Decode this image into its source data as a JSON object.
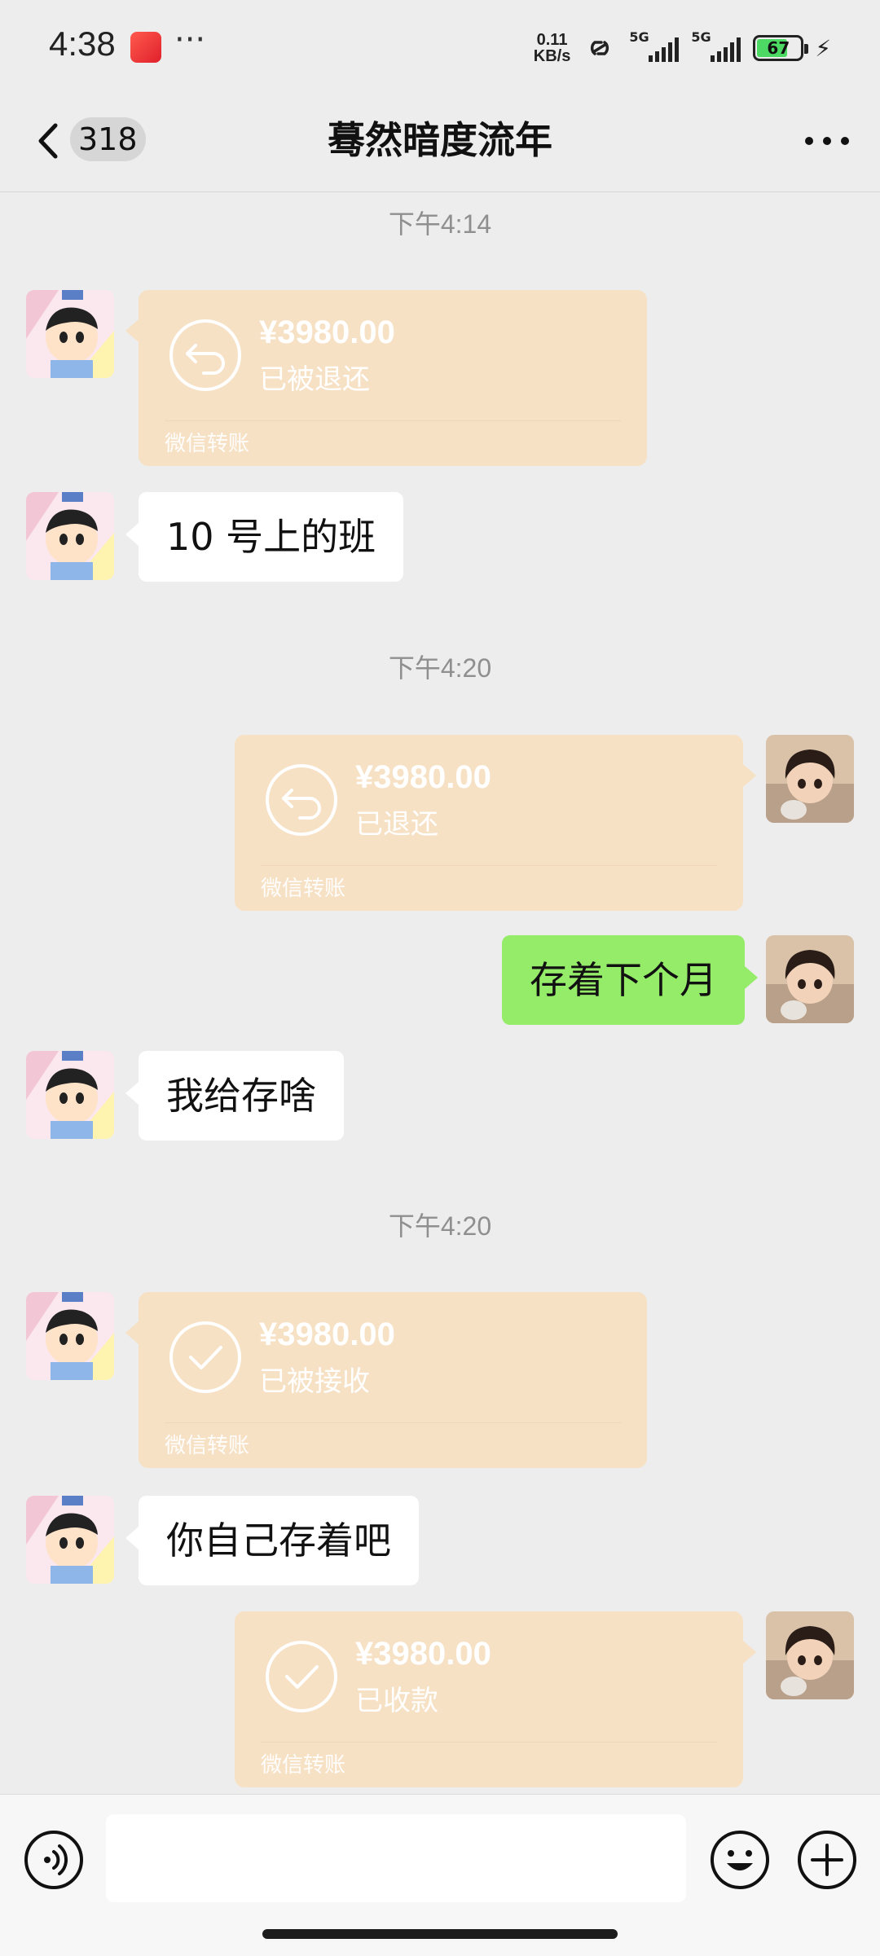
{
  "status_bar": {
    "time": "4:38",
    "speed_value": "0.11",
    "speed_unit": "KB/s",
    "signal1_label": "5G",
    "signal2_label": "5G",
    "battery_level": "67",
    "icons": [
      "app-shortcut-icon",
      "more-dots-icon",
      "link-icon",
      "signal-icon",
      "battery-icon",
      "charging-icon"
    ]
  },
  "nav": {
    "unread_count": "318",
    "title": "蓦然暗度流年",
    "icons": [
      "back-chevron-icon",
      "more-icon"
    ]
  },
  "messages": {
    "ts1": "下午4:14",
    "m1": {
      "amount": "¥3980.00",
      "status": "已被退还",
      "label": "微信转账"
    },
    "m2": "10 号上的班",
    "ts2": "下午4:20",
    "m3": {
      "amount": "¥3980.00",
      "status": "已退还",
      "label": "微信转账"
    },
    "m4": "存着下个月",
    "m5": "我给存啥",
    "ts3": "下午4:20",
    "m6": {
      "amount": "¥3980.00",
      "status": "已被接收",
      "label": "微信转账"
    },
    "m7": "你自己存着吧",
    "m8": {
      "amount": "¥3980.00",
      "status": "已收款",
      "label": "微信转账"
    }
  },
  "input_bar": {
    "value": "",
    "icons": [
      "voice-icon",
      "emoji-icon",
      "plus-icon"
    ]
  },
  "colors": {
    "background": "#ededed",
    "transfer_card": "#f7e1c5",
    "sent_bubble": "#95ec69",
    "received_bubble": "#ffffff"
  }
}
